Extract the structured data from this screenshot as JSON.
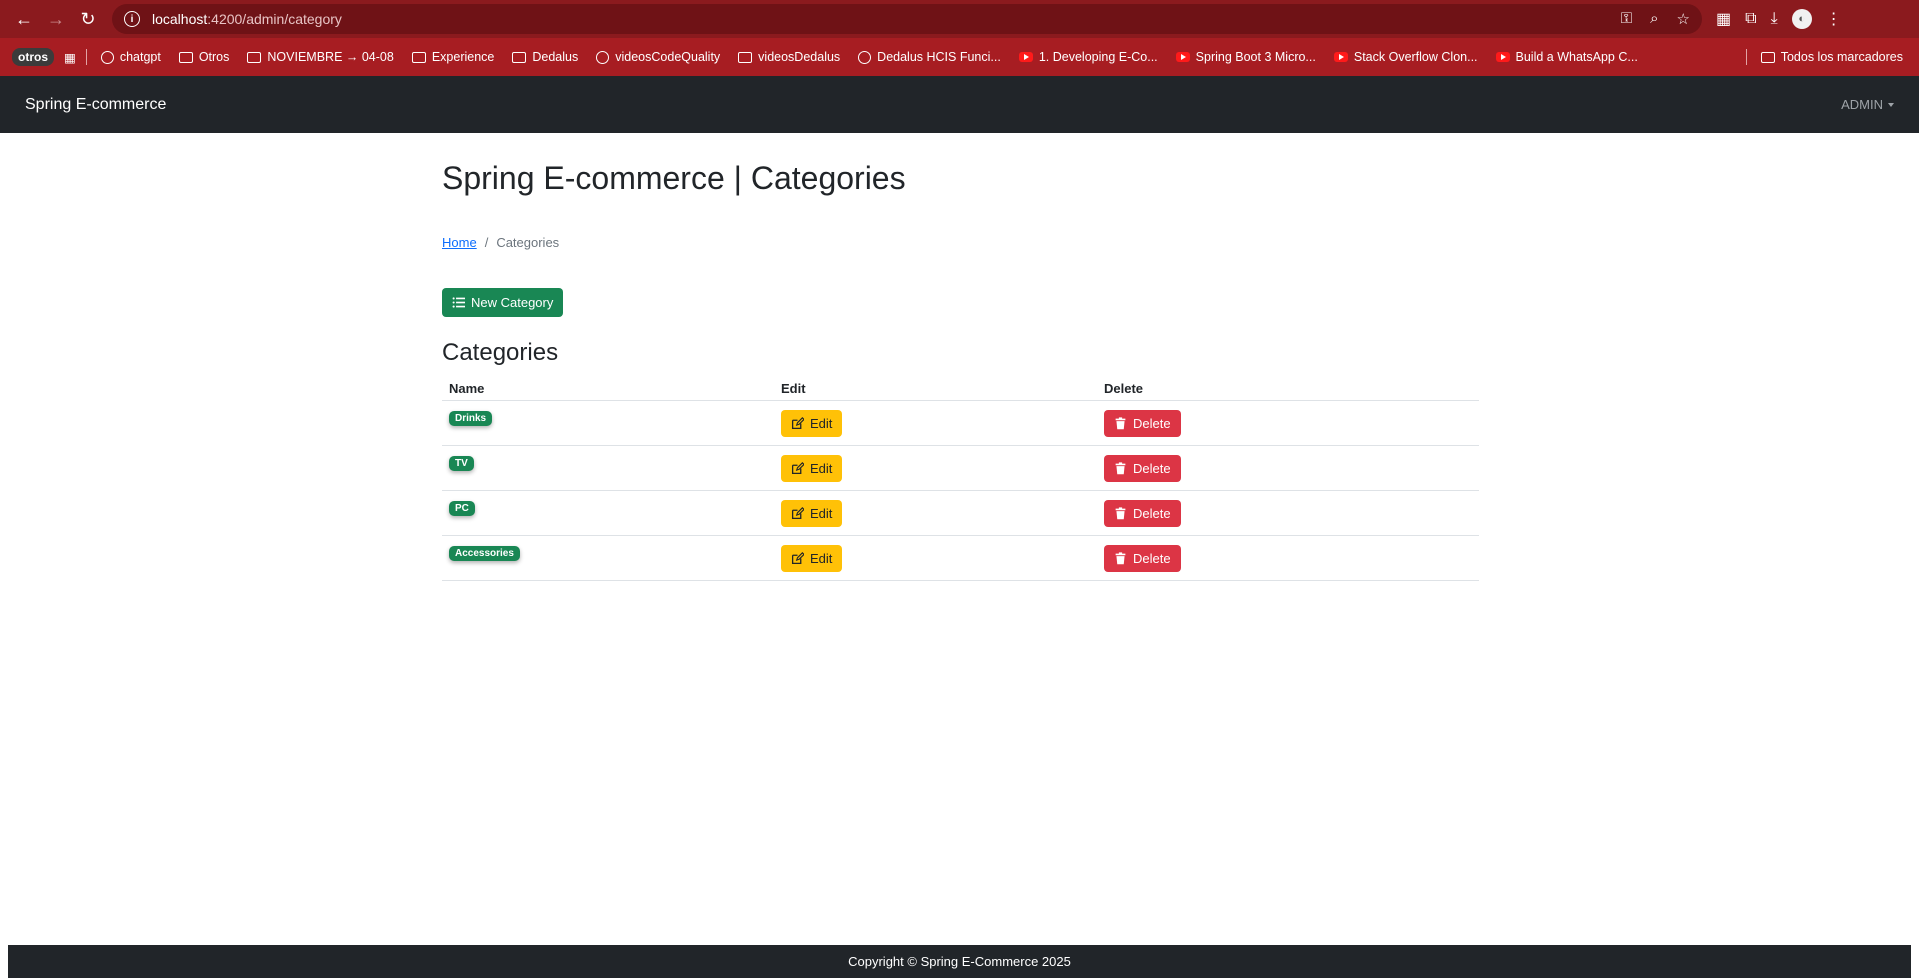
{
  "browser": {
    "url_host": "localhost",
    "url_path": ":4200/admin/category",
    "bookmarks": [
      {
        "label": "chatgpt"
      },
      {
        "label": "Otros"
      },
      {
        "label": "NOVIEMBRE → 04-08"
      },
      {
        "label": "Experience"
      },
      {
        "label": "Dedalus"
      },
      {
        "label": "videosCodeQuality"
      },
      {
        "label": "videosDedalus"
      },
      {
        "label": "Dedalus HCIS Funci..."
      },
      {
        "label": "1. Developing E-Co..."
      },
      {
        "label": "Spring Boot 3 Micro..."
      },
      {
        "label": "Stack Overflow Clon..."
      },
      {
        "label": "Build a WhatsApp C..."
      }
    ],
    "pill_label": "otros",
    "all_bookmarks": "Todos los marcadores"
  },
  "navbar": {
    "brand": "Spring E-commerce",
    "admin": "ADMIN"
  },
  "page": {
    "title": "Spring E-commerce | Categories",
    "breadcrumb": {
      "home": "Home",
      "current": "Categories"
    },
    "new_button": "New Category",
    "section_title": "Categories",
    "columns": {
      "name": "Name",
      "edit": "Edit",
      "delete": "Delete"
    },
    "rows": [
      {
        "name": "Drinks",
        "edit": "Edit",
        "delete": "Delete"
      },
      {
        "name": "TV",
        "edit": "Edit",
        "delete": "Delete"
      },
      {
        "name": "PC",
        "edit": "Edit",
        "delete": "Delete"
      },
      {
        "name": "Accessories",
        "edit": "Edit",
        "delete": "Delete"
      }
    ]
  },
  "footer": {
    "text": "Copyright © Spring E-Commerce 2025"
  },
  "colors": {
    "browser_frame": "#8b1a1e",
    "navbar": "#212529",
    "success": "#198754",
    "warning": "#ffc107",
    "danger": "#dc3545"
  }
}
